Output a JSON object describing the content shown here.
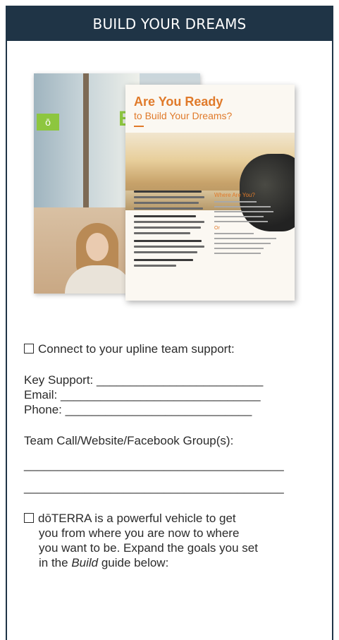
{
  "header": {
    "title": "BUILD YOUR DREAMS"
  },
  "figure": {
    "back_badge": "ō",
    "back_big_letter": "B",
    "front_title_line1": "Are You Ready",
    "front_title_line2": "to Build Your Dreams?",
    "side_title": "Where Are You?",
    "side_sub": "Or"
  },
  "checklist": {
    "item1_label": "Connect to your upline team support:",
    "key_support": "Key Support: _________________________",
    "email": "Email: ______________________________",
    "phone": "Phone: ____________________________",
    "team_call": "Team Call/Website/Facebook Group(s):",
    "blank_line1": "_______________________________________",
    "blank_line2": "_______________________________________",
    "item2_line1": "dōTERRA is a powerful vehicle to get",
    "item2_line2": "you from where you are now to where",
    "item2_line3": "you want to be. Expand the goals you set",
    "item2_line4_pre": "in the ",
    "item2_line4_em": "Build",
    "item2_line4_post": " guide below:"
  },
  "colors": {
    "header_bg": "#1f3446",
    "accent_green": "#8dc63f",
    "accent_orange": "#e07a2a"
  }
}
